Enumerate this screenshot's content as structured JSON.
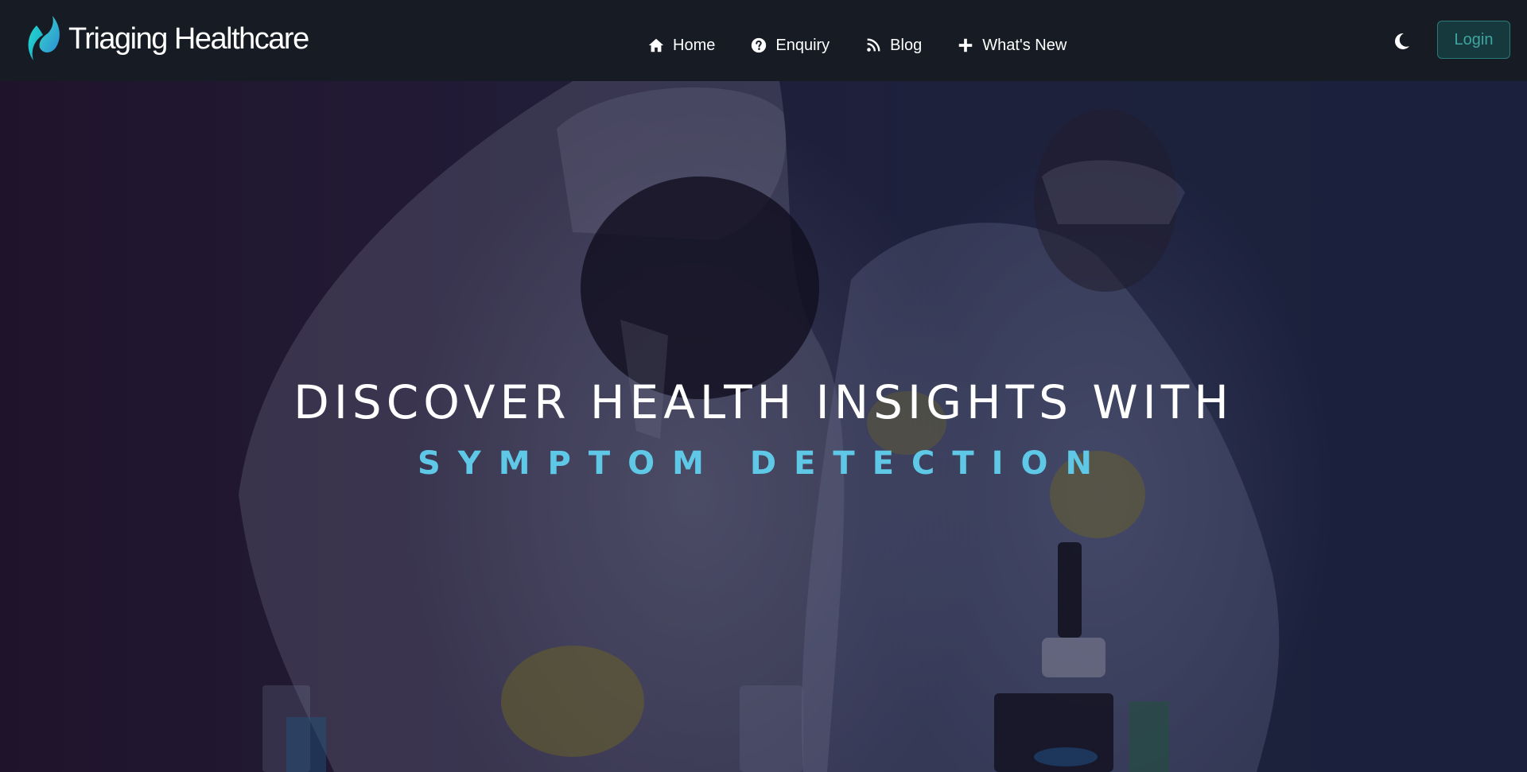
{
  "brand": {
    "name": "Triaging Healthcare",
    "logo_icon": "droplet-leaf-logo"
  },
  "nav": {
    "items": [
      {
        "label": "Home",
        "icon": "home-icon"
      },
      {
        "label": "Enquiry",
        "icon": "question-circle-icon"
      },
      {
        "label": "Blog",
        "icon": "rss-blog-icon"
      },
      {
        "label": "What's New",
        "icon": "plus-icon"
      }
    ]
  },
  "header": {
    "theme_toggle_icon": "moon-icon",
    "login_label": "Login"
  },
  "hero": {
    "title": "DISCOVER HEALTH INSIGHTS WITH",
    "subtitle": "SYMPTOM DETECTION",
    "image": "lab-scientists-background"
  },
  "colors": {
    "navbar_bg": "#171c24",
    "accent": "#5ec8e6",
    "login_text": "#3fa5a0",
    "login_border": "#2a7a7a"
  }
}
